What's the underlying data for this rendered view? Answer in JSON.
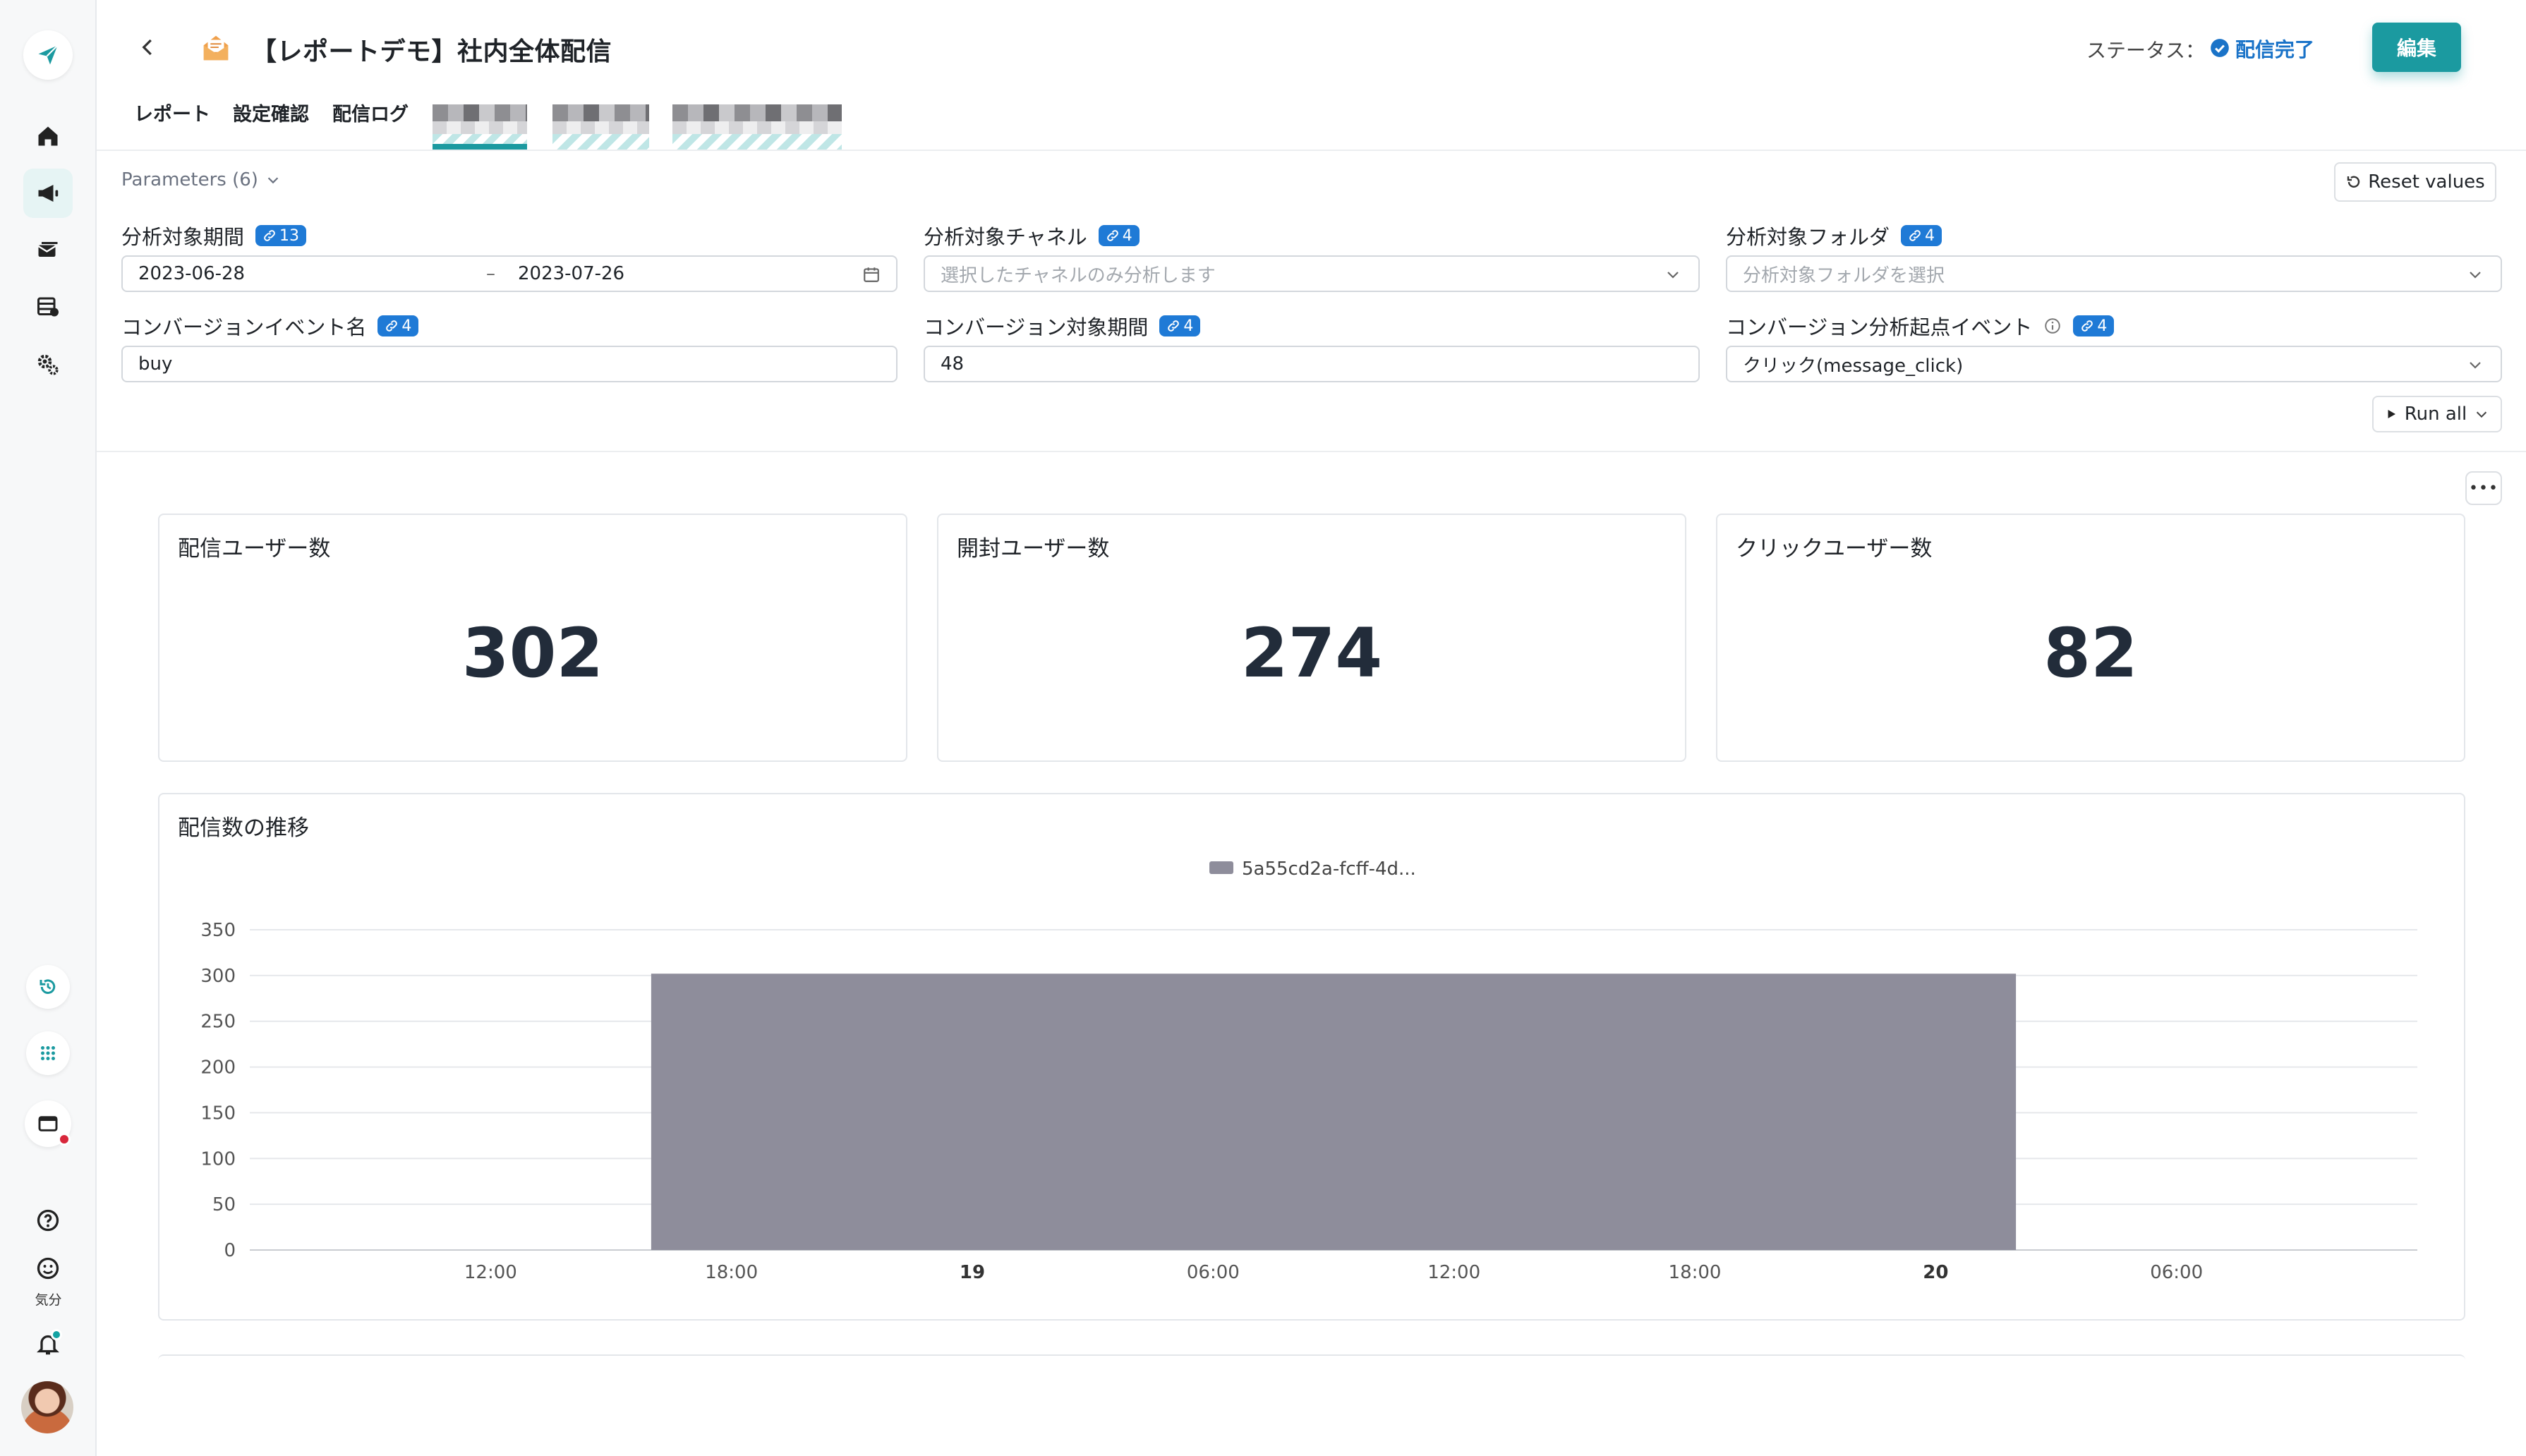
{
  "header": {
    "title": "【レポートデモ】社内全体配信",
    "status_label": "ステータス：",
    "status_value": "配信完了",
    "edit_label": "編集"
  },
  "tabs": [
    "レポート",
    "設定確認",
    "配信ログ"
  ],
  "rail": {
    "mood_label": "気分"
  },
  "parameters": {
    "toggle_label": "Parameters (6)",
    "reset_label": "Reset values",
    "run_label": "Run all",
    "period": {
      "label": "分析対象期間",
      "badge": "13",
      "start": "2023-06-28",
      "separator": "–",
      "end": "2023-07-26"
    },
    "channel": {
      "label": "分析対象チャネル",
      "badge": "4",
      "placeholder": "選択したチャネルのみ分析します"
    },
    "folder": {
      "label": "分析対象フォルダ",
      "badge": "4",
      "placeholder": "分析対象フォルダを選択"
    },
    "conversion_event": {
      "label": "コンバージョンイベント名",
      "badge": "4",
      "value": "buy"
    },
    "conversion_period": {
      "label": "コンバージョン対象期間",
      "badge": "4",
      "value": "48"
    },
    "origin_event": {
      "label": "コンバージョン分析起点イベント",
      "badge": "4",
      "value": "クリック(message_click)"
    }
  },
  "kpis": [
    {
      "title": "配信ユーザー数",
      "value": "302"
    },
    {
      "title": "開封ユーザー数",
      "value": "274"
    },
    {
      "title": "クリックユーザー数",
      "value": "82"
    }
  ],
  "chart_card": {
    "title": "配信数の推移"
  },
  "chart_data": {
    "type": "bar",
    "title": "配信数の推移",
    "series": [
      {
        "name": "5a55cd2a-fcff-4d...",
        "color": "#8e8d9b",
        "x_start": "18 16:00",
        "x_end": "20 02:00",
        "value": 302
      }
    ],
    "ylim": [
      0,
      350
    ],
    "yticks": [
      0,
      50,
      100,
      150,
      200,
      250,
      300,
      350
    ],
    "xticks": [
      {
        "label": "12:00",
        "hours": 12,
        "bold": false
      },
      {
        "label": "18:00",
        "hours": 18,
        "bold": false
      },
      {
        "label": "19",
        "hours": 24,
        "bold": true
      },
      {
        "label": "06:00",
        "hours": 30,
        "bold": false
      },
      {
        "label": "12:00",
        "hours": 36,
        "bold": false
      },
      {
        "label": "18:00",
        "hours": 42,
        "bold": false
      },
      {
        "label": "20",
        "hours": 48,
        "bold": true
      },
      {
        "label": "06:00",
        "hours": 54,
        "bold": false
      }
    ],
    "grid": true,
    "legend": "top-center"
  }
}
